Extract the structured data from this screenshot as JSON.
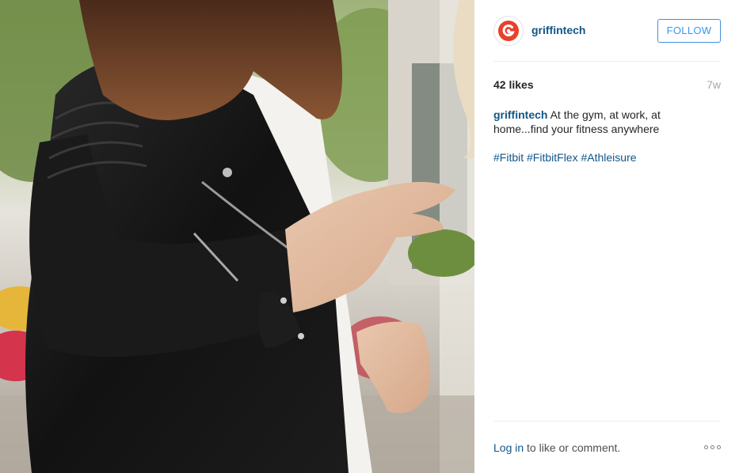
{
  "photo": {
    "description_icon": "photo"
  },
  "header": {
    "username": "griffintech",
    "follow_label": "FOLLOW",
    "avatar_icon": "griffin-logo-icon",
    "brand_color": "#e8412c"
  },
  "meta": {
    "likes": "42 likes",
    "age": "7w"
  },
  "caption": {
    "user": "griffintech",
    "text": " At the gym, at work, at home...find your fitness anywhere"
  },
  "hashtags": [
    {
      "label": "#Fitbit"
    },
    {
      "label": "#FitbitFlex"
    },
    {
      "label": "#Athleisure"
    }
  ],
  "footer": {
    "login_label": "Log in",
    "rest_label": " to like or comment.",
    "more_icon": "more-options-icon"
  },
  "colors": {
    "link": "#125688",
    "follow": "#3897f0",
    "muted": "#a5a7aa"
  }
}
